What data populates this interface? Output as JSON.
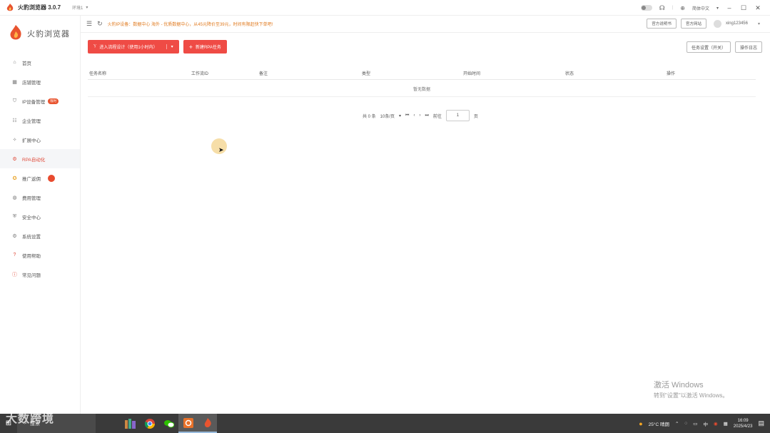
{
  "window": {
    "title": "火豹浏览器 3.0.7",
    "env_label": "环境1",
    "language": "简体中文",
    "controls": [
      "–",
      "☐",
      "✕"
    ]
  },
  "sidebar": {
    "brand": "火豹浏览器",
    "items": [
      {
        "label": "首页",
        "icon": "home-icon"
      },
      {
        "label": "店铺管理",
        "icon": "grid-icon"
      },
      {
        "label": "IP设备管理",
        "icon": "shield-icon",
        "badge": "限时"
      },
      {
        "label": "企业管理",
        "icon": "users-icon"
      },
      {
        "label": "扩展中心",
        "icon": "puzzle-icon"
      },
      {
        "label": "RPA自动化",
        "icon": "robot-icon",
        "active": true
      },
      {
        "label": "推广返佣",
        "icon": "gift-icon",
        "badge_round": true
      },
      {
        "label": "费用管理",
        "icon": "wallet-icon"
      },
      {
        "label": "安全中心",
        "icon": "lock-icon"
      },
      {
        "label": "系统设置",
        "icon": "gear-icon"
      },
      {
        "label": "使用帮助",
        "icon": "help-icon"
      },
      {
        "label": "常见问题",
        "icon": "info-icon"
      }
    ]
  },
  "header": {
    "notice": "火豹IP设备：数据中心 海外 - 优质数据中心，从45元降价至39元，时间有限赶快下单吧!",
    "btn_docs": "官方说明书",
    "btn_website": "官方网站",
    "username": "xing123456"
  },
  "toolbar": {
    "enter_flow": "进入流程设计（使用1小时内）",
    "new_task": "新建RPA任务",
    "btn_settings": "任务设置（开关）",
    "btn_log": "操作日志"
  },
  "table": {
    "columns": [
      "任务名称",
      "工作流ID",
      "备注",
      "类型",
      "开始时间",
      "状态",
      "操作"
    ],
    "empty_text": "暂无数据"
  },
  "pager": {
    "total": "共 0 条",
    "page_size": "10条/页",
    "goto_label": "前往",
    "page": "1",
    "page_suffix": "页"
  },
  "activate": {
    "line1": "激活 Windows",
    "line2": "转到\"设置\"以激活 Windows。"
  },
  "taskbar": {
    "search": "搜索",
    "watermark": "大数跨境",
    "weather": "25°C 晴朗",
    "ime": "中",
    "time": "16:09",
    "date": "2025/4/23"
  },
  "colors": {
    "accent": "#ef4b45",
    "notice": "#e07a1f"
  }
}
